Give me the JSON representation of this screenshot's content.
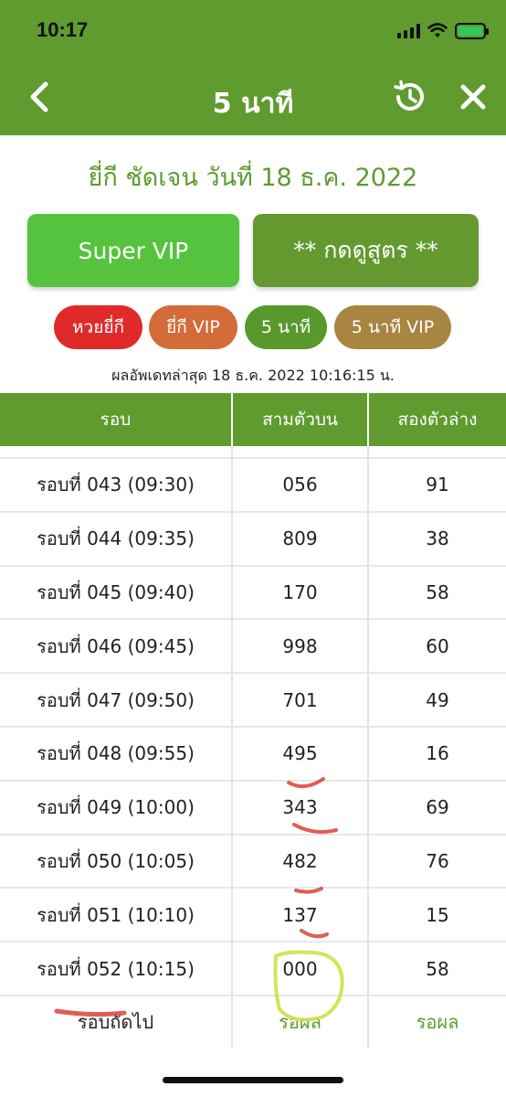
{
  "status_bar": {
    "time": "10:17"
  },
  "nav": {
    "title": "5 นาที"
  },
  "subtitle": "ยี่กี ชัดเจน วันที่ 18 ธ.ค. 2022",
  "buttons": {
    "super_vip": "Super VIP",
    "formula": "** กดดูสูตร **"
  },
  "tabs": [
    "หวยยี่กี",
    "ยี่กี VIP",
    "5 นาที",
    "5 นาที VIP"
  ],
  "updated_text": "ผลอัพเดทล่าสุด 18 ธ.ค. 2022 10:16:15 น.",
  "table": {
    "headers": [
      "รอบ",
      "สามตัวบน",
      "สองตัวล่าง"
    ],
    "rows": [
      [
        "รอบที่ 043 (09:30)",
        "056",
        "91"
      ],
      [
        "รอบที่ 044 (09:35)",
        "809",
        "38"
      ],
      [
        "รอบที่ 045 (09:40)",
        "170",
        "58"
      ],
      [
        "รอบที่ 046 (09:45)",
        "998",
        "60"
      ],
      [
        "รอบที่ 047 (09:50)",
        "701",
        "49"
      ],
      [
        "รอบที่ 048 (09:55)",
        "495",
        "16"
      ],
      [
        "รอบที่ 049 (10:00)",
        "343",
        "69"
      ],
      [
        "รอบที่ 050 (10:05)",
        "482",
        "76"
      ],
      [
        "รอบที่ 051 (10:10)",
        "137",
        "15"
      ],
      [
        "รอบที่ 052 (10:15)",
        "000",
        "58"
      ]
    ],
    "next_row": [
      "รอบถัดไป",
      "รอผล",
      "รอผล"
    ]
  },
  "colors": {
    "header_green": "#5f9b2f",
    "super_vip": "#55c33e",
    "tab_red": "#e02a2a",
    "tab_orange": "#d46c3a",
    "tab_green": "#58992e",
    "tab_gold": "#a88541",
    "annotation_red": "#d8423a",
    "annotation_yellow": "#cfe04a"
  },
  "icons": [
    "back-chevron-icon",
    "history-icon",
    "close-icon",
    "signal-icon",
    "wifi-icon",
    "battery-charging-icon"
  ]
}
